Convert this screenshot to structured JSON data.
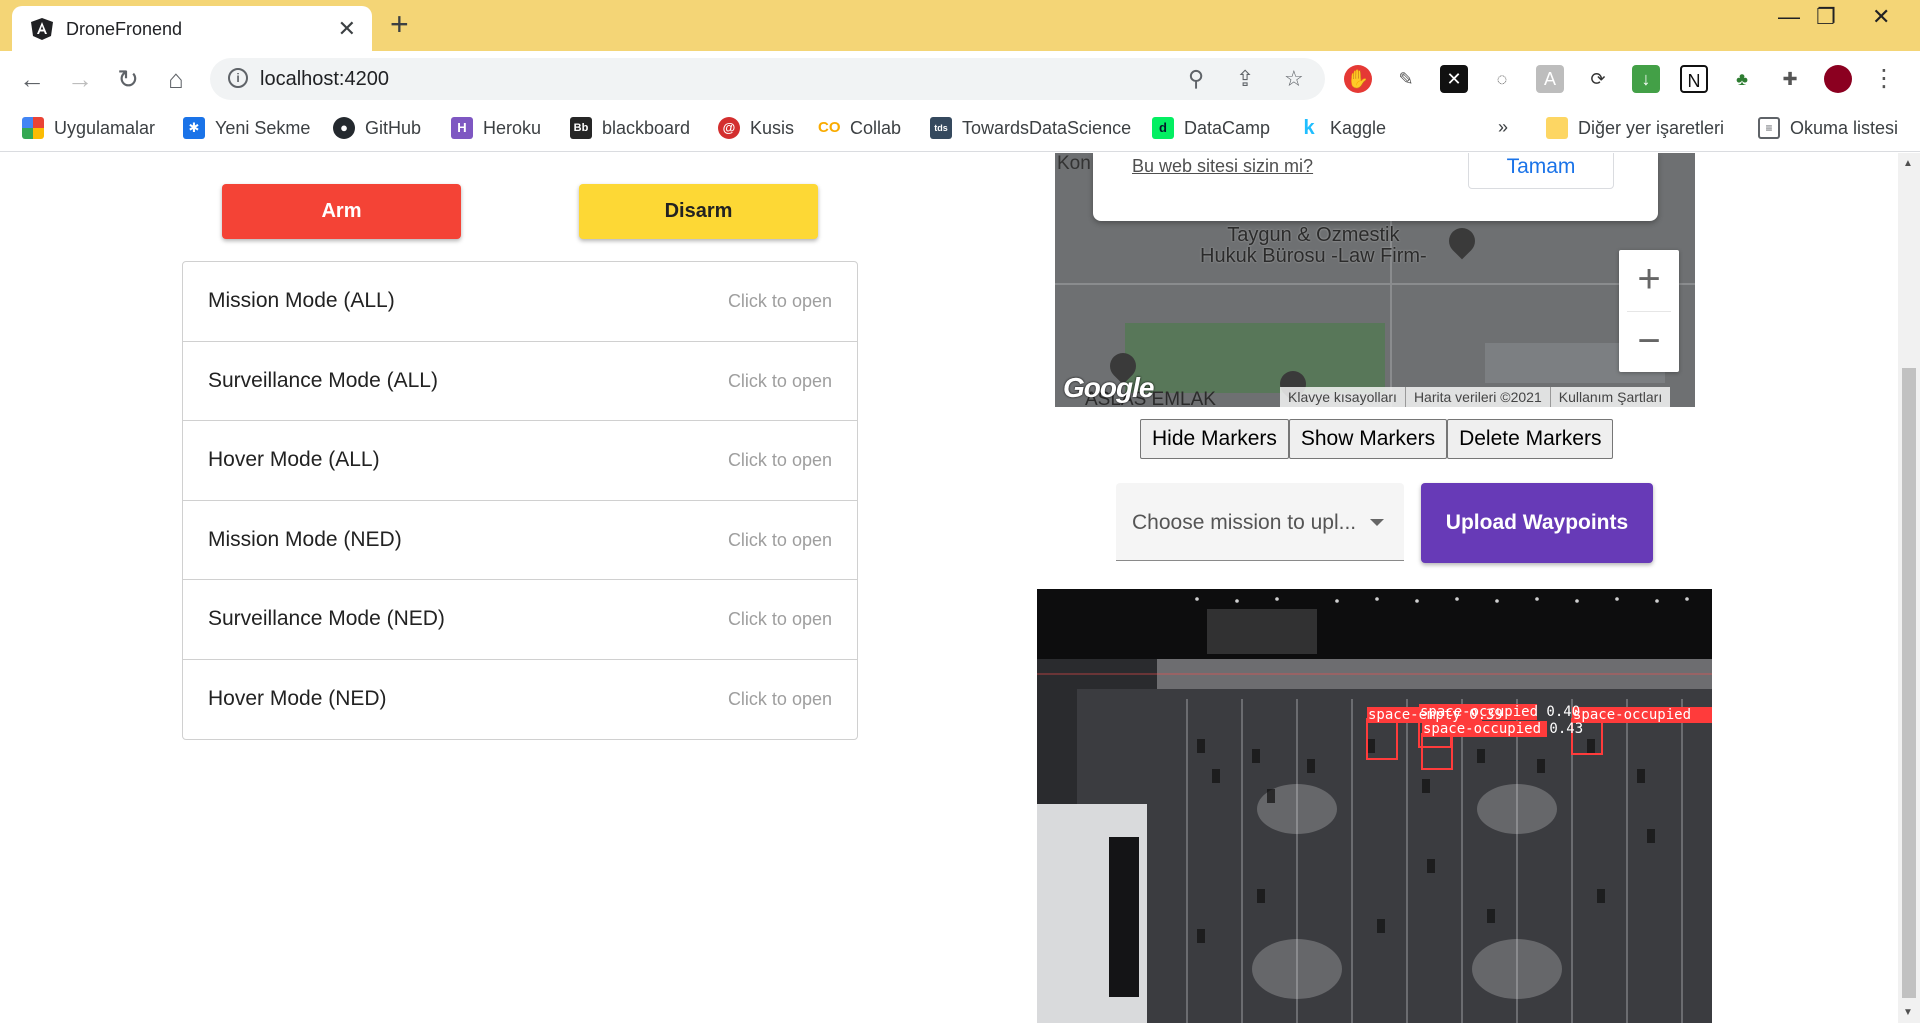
{
  "browser": {
    "tab_title": "DroneFronend",
    "tab_close": "✕",
    "new_tab": "+",
    "url": "localhost:4200",
    "window": {
      "minimize": "—",
      "restore": "❐",
      "close": "✕"
    }
  },
  "bookmarks": [
    {
      "label": "Uygulamalar",
      "icon": "apps-grid-icon",
      "color": "#ea4335"
    },
    {
      "label": "Yeni Sekme",
      "icon": "gear-icon",
      "color": "#1a73e8"
    },
    {
      "label": "GitHub",
      "icon": "github-icon",
      "color": "#24292e"
    },
    {
      "label": "Heroku",
      "icon": "heroku-icon",
      "color": "#7e57c2"
    },
    {
      "label": "blackboard",
      "icon": "blackboard-icon",
      "color": "#262626"
    },
    {
      "label": "Kusis",
      "icon": "kusis-icon",
      "color": "#d32f2f"
    },
    {
      "label": "Collab",
      "icon": "colab-icon",
      "color": "#f9ab00"
    },
    {
      "label": "TowardsDataScience",
      "icon": "tds-icon",
      "color": "#35495e"
    },
    {
      "label": "DataCamp",
      "icon": "datacamp-icon",
      "color": "#03ef62"
    },
    {
      "label": "Kaggle",
      "icon": "kaggle-icon",
      "color": "#20beff"
    }
  ],
  "bookmarks_more": "»",
  "bookmarks_other": "Diğer yer işaretleri",
  "reading_list": "Okuma listesi",
  "controls": {
    "arm_label": "Arm",
    "disarm_label": "Disarm"
  },
  "modes": [
    {
      "label": "Mission Mode (ALL)",
      "hint": "Click to open"
    },
    {
      "label": "Surveillance Mode (ALL)",
      "hint": "Click to open"
    },
    {
      "label": "Hover Mode (ALL)",
      "hint": "Click to open"
    },
    {
      "label": "Mission Mode (NED)",
      "hint": "Click to open"
    },
    {
      "label": "Surveillance Mode (NED)",
      "hint": "Click to open"
    },
    {
      "label": "Hover Mode (NED)",
      "hint": "Click to open"
    }
  ],
  "map": {
    "corner_text": "Kon",
    "popup_question": "Bu web sitesi sizin mi?",
    "popup_ok": "Tamam",
    "poi_line1": "Taygun & Ozmestik",
    "poi_line2": "Hukuk Bürosu -Law Firm-",
    "bottom_text": "ASLAS EMLAK",
    "zoom_in": "+",
    "zoom_out": "−",
    "logo": "Google",
    "attribution": [
      "Klavye kısayolları",
      "Harita verileri ©2021",
      "Kullanım Şartları"
    ]
  },
  "markers": {
    "hide_label": "Hide Markers",
    "show_label": "Show Markers",
    "delete_label": "Delete Markers"
  },
  "mission_select": {
    "value": "Choose mission to upl..."
  },
  "upload_label": "Upload Waypoints",
  "detections": [
    "space-empty 0.39",
    "space-occupied 0.40",
    "space-occupied 0.43",
    "space-occupied"
  ]
}
